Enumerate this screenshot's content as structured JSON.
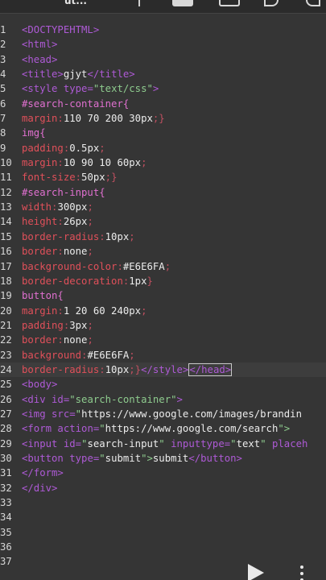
{
  "toolbar": {
    "label": "ut..."
  },
  "editor": {
    "lines": [
      {
        "n": "1",
        "tokens": [
          {
            "t": "<DOCTYPEHTML>",
            "c": "tag"
          }
        ]
      },
      {
        "n": "2",
        "tokens": [
          {
            "t": "<html>",
            "c": "tag"
          }
        ]
      },
      {
        "n": "3",
        "tokens": [
          {
            "t": "<head>",
            "c": "tag"
          }
        ]
      },
      {
        "n": "4",
        "tokens": [
          {
            "t": "<title>",
            "c": "tag"
          },
          {
            "t": "gjyt",
            "c": "text"
          },
          {
            "t": "</title>",
            "c": "tag"
          }
        ]
      },
      {
        "n": "5",
        "tokens": [
          {
            "t": "<style ",
            "c": "tag"
          },
          {
            "t": "type=",
            "c": "attr"
          },
          {
            "t": "\"text/css\"",
            "c": "str"
          },
          {
            "t": ">",
            "c": "tag"
          }
        ]
      },
      {
        "n": "6",
        "tokens": [
          {
            "t": "#search-container{",
            "c": "sel"
          }
        ]
      },
      {
        "n": "7",
        "tokens": [
          {
            "t": "margin",
            "c": "prop"
          },
          {
            "t": ":",
            "c": "punc"
          },
          {
            "t": "110 70 200 30px",
            "c": "text"
          },
          {
            "t": ";}",
            "c": "punc"
          }
        ]
      },
      {
        "n": "8",
        "tokens": [
          {
            "t": "img{",
            "c": "sel"
          }
        ]
      },
      {
        "n": "9",
        "tokens": [
          {
            "t": "padding",
            "c": "prop"
          },
          {
            "t": ":",
            "c": "punc"
          },
          {
            "t": "0.5px",
            "c": "text"
          },
          {
            "t": ";",
            "c": "punc"
          }
        ]
      },
      {
        "n": "10",
        "tokens": [
          {
            "t": "margin",
            "c": "prop"
          },
          {
            "t": ":",
            "c": "punc"
          },
          {
            "t": "10 90 10 60px",
            "c": "text"
          },
          {
            "t": ";",
            "c": "punc"
          }
        ]
      },
      {
        "n": "11",
        "tokens": [
          {
            "t": "font-size",
            "c": "prop"
          },
          {
            "t": ":",
            "c": "punc"
          },
          {
            "t": "50px",
            "c": "text"
          },
          {
            "t": ";}",
            "c": "punc"
          }
        ]
      },
      {
        "n": "12",
        "tokens": [
          {
            "t": "#search-input{",
            "c": "sel"
          }
        ]
      },
      {
        "n": "13",
        "tokens": [
          {
            "t": "width",
            "c": "prop"
          },
          {
            "t": ":",
            "c": "punc"
          },
          {
            "t": "300px",
            "c": "text"
          },
          {
            "t": ";",
            "c": "punc"
          }
        ]
      },
      {
        "n": "14",
        "tokens": [
          {
            "t": "height",
            "c": "prop"
          },
          {
            "t": ":",
            "c": "punc"
          },
          {
            "t": "26px",
            "c": "text"
          },
          {
            "t": ";",
            "c": "punc"
          }
        ]
      },
      {
        "n": "15",
        "tokens": [
          {
            "t": "border-radius",
            "c": "prop"
          },
          {
            "t": ":",
            "c": "punc"
          },
          {
            "t": "10px",
            "c": "text"
          },
          {
            "t": ";",
            "c": "punc"
          }
        ]
      },
      {
        "n": "16",
        "tokens": [
          {
            "t": "border",
            "c": "prop"
          },
          {
            "t": ":",
            "c": "punc"
          },
          {
            "t": "none",
            "c": "text"
          },
          {
            "t": ";",
            "c": "punc"
          }
        ]
      },
      {
        "n": "17",
        "tokens": [
          {
            "t": "background-color",
            "c": "prop"
          },
          {
            "t": ":",
            "c": "punc"
          },
          {
            "t": "#E6E6FA",
            "c": "text"
          },
          {
            "t": ";",
            "c": "punc"
          }
        ]
      },
      {
        "n": "18",
        "tokens": [
          {
            "t": "border-decoration",
            "c": "prop"
          },
          {
            "t": ":",
            "c": "punc"
          },
          {
            "t": "1px",
            "c": "text"
          },
          {
            "t": "}",
            "c": "punc"
          }
        ]
      },
      {
        "n": "19",
        "tokens": [
          {
            "t": "button{",
            "c": "sel"
          }
        ]
      },
      {
        "n": "20",
        "tokens": [
          {
            "t": "margin",
            "c": "prop"
          },
          {
            "t": ":",
            "c": "punc"
          },
          {
            "t": "1 20 60 240px",
            "c": "text"
          },
          {
            "t": ";",
            "c": "punc"
          }
        ]
      },
      {
        "n": "21",
        "tokens": [
          {
            "t": "padding",
            "c": "prop"
          },
          {
            "t": ":",
            "c": "punc"
          },
          {
            "t": "3px",
            "c": "text"
          },
          {
            "t": ";",
            "c": "punc"
          }
        ]
      },
      {
        "n": "22",
        "tokens": [
          {
            "t": "border",
            "c": "prop"
          },
          {
            "t": ":",
            "c": "punc"
          },
          {
            "t": "none",
            "c": "text"
          },
          {
            "t": ";",
            "c": "punc"
          }
        ]
      },
      {
        "n": "23",
        "tokens": [
          {
            "t": "background",
            "c": "prop"
          },
          {
            "t": ":",
            "c": "punc"
          },
          {
            "t": "#E6E6FA",
            "c": "text"
          },
          {
            "t": ";",
            "c": "punc"
          }
        ]
      },
      {
        "n": "24",
        "current": true,
        "tokens": [
          {
            "t": "border-radius",
            "c": "prop"
          },
          {
            "t": ":",
            "c": "punc"
          },
          {
            "t": "10px",
            "c": "text"
          },
          {
            "t": ";}",
            "c": "punc"
          },
          {
            "t": "</style>",
            "c": "tag"
          },
          {
            "t": "|",
            "c": "cursor"
          },
          {
            "t": "</head>",
            "c": "tag",
            "boxed": true
          }
        ]
      },
      {
        "n": "25",
        "tokens": [
          {
            "t": "<body>",
            "c": "tag"
          }
        ]
      },
      {
        "n": "26",
        "tokens": [
          {
            "t": "<div ",
            "c": "tag"
          },
          {
            "t": "id=",
            "c": "attr"
          },
          {
            "t": "\"search-container\"",
            "c": "str"
          },
          {
            "t": ">",
            "c": "tag"
          }
        ]
      },
      {
        "n": "27",
        "tokens": [
          {
            "t": "<img ",
            "c": "tag"
          },
          {
            "t": "src=",
            "c": "attr"
          },
          {
            "t": "\"",
            "c": "str"
          },
          {
            "t": "https://www.google.com/images/brandin",
            "c": "text"
          }
        ]
      },
      {
        "n": "28",
        "tokens": [
          {
            "t": "<form ",
            "c": "tag"
          },
          {
            "t": "action=",
            "c": "attr"
          },
          {
            "t": "\"",
            "c": "str"
          },
          {
            "t": "https://www.google.com/search",
            "c": "text"
          },
          {
            "t": "\">",
            "c": "str"
          }
        ]
      },
      {
        "n": "29",
        "tokens": [
          {
            "t": "<input ",
            "c": "tag"
          },
          {
            "t": "id=",
            "c": "attr"
          },
          {
            "t": "\"",
            "c": "str"
          },
          {
            "t": "search-input",
            "c": "text"
          },
          {
            "t": "\" ",
            "c": "str"
          },
          {
            "t": "inputtype=",
            "c": "attr"
          },
          {
            "t": "\"",
            "c": "str"
          },
          {
            "t": "text",
            "c": "text"
          },
          {
            "t": "\" ",
            "c": "str"
          },
          {
            "t": "placeh",
            "c": "attr"
          }
        ]
      },
      {
        "n": "30",
        "tokens": [
          {
            "t": "<button ",
            "c": "tag"
          },
          {
            "t": "type=",
            "c": "attr"
          },
          {
            "t": "\"",
            "c": "str"
          },
          {
            "t": "submit",
            "c": "text"
          },
          {
            "t": "\">",
            "c": "str"
          },
          {
            "t": "submit",
            "c": "text"
          },
          {
            "t": "</button>",
            "c": "tag"
          }
        ]
      },
      {
        "n": "31",
        "tokens": [
          {
            "t": "</form>",
            "c": "tag"
          }
        ]
      },
      {
        "n": "32",
        "tokens": [
          {
            "t": "</div>",
            "c": "tag"
          }
        ]
      },
      {
        "n": "33",
        "tokens": []
      },
      {
        "n": "34",
        "tokens": []
      },
      {
        "n": "35",
        "tokens": []
      },
      {
        "n": "36",
        "tokens": []
      },
      {
        "n": "37",
        "tokens": []
      }
    ]
  },
  "controls": {
    "run_icon": "play-icon",
    "menu_icon": "more-vertical-icon"
  }
}
